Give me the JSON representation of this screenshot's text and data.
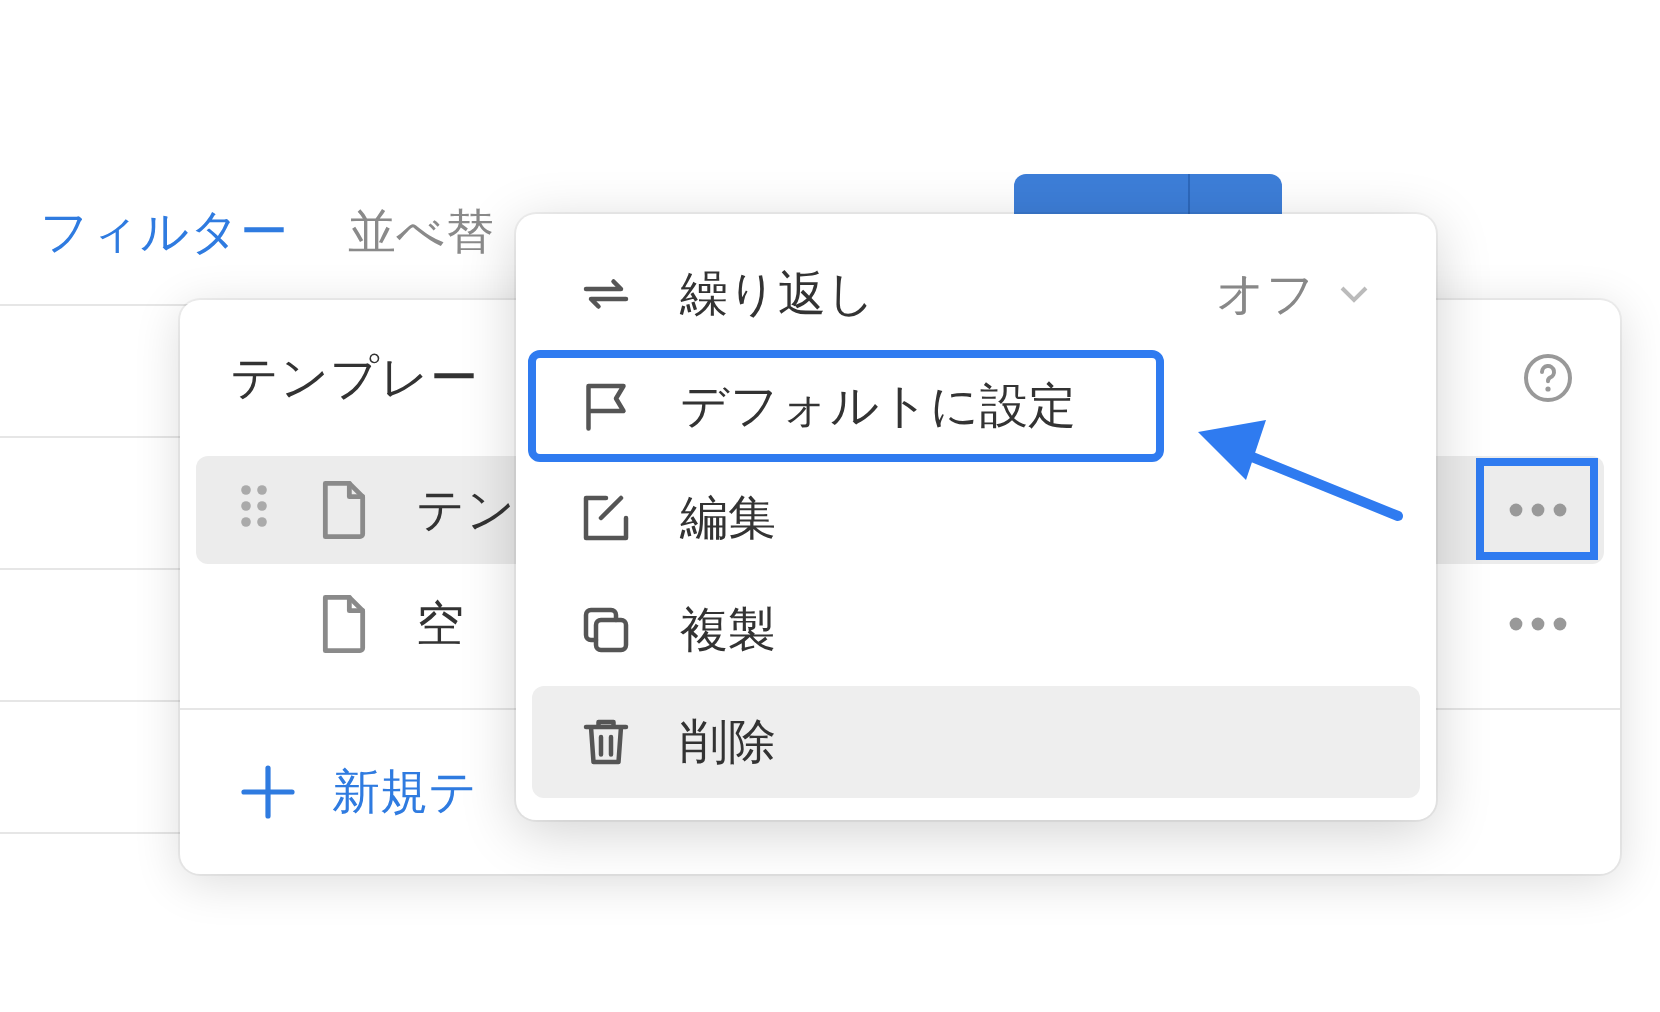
{
  "toolbar": {
    "filter_label": "フィルター",
    "sort_label": "並べ替"
  },
  "template_popover": {
    "title": "テンプレー",
    "rows": [
      {
        "name": "テン",
        "selected": true,
        "draggable": true,
        "outlined": true
      },
      {
        "name": "空",
        "selected": false,
        "draggable": false,
        "outlined": false
      }
    ],
    "new_template_label": "新規テ"
  },
  "context_menu": {
    "items": [
      {
        "kind": "toggle",
        "label": "繰り返し",
        "value": "オフ",
        "selected": false,
        "outlined": false
      },
      {
        "kind": "action",
        "label": "デフォルトに設定",
        "selected": false,
        "outlined": true
      },
      {
        "kind": "action",
        "label": "編集",
        "selected": false,
        "outlined": false
      },
      {
        "kind": "action",
        "label": "複製",
        "selected": false,
        "outlined": false
      },
      {
        "kind": "action",
        "label": "削除",
        "selected": true,
        "outlined": false
      }
    ]
  }
}
